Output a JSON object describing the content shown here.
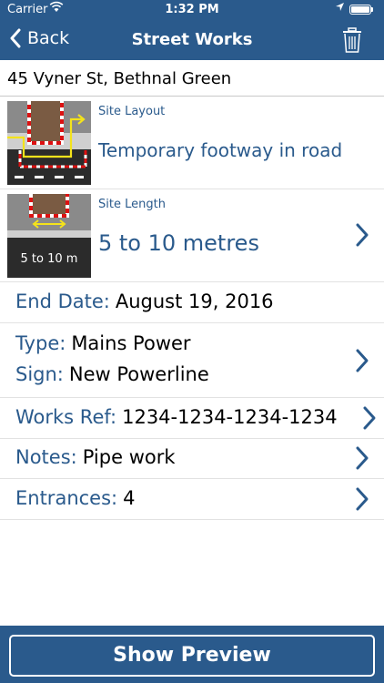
{
  "status_bar": {
    "carrier": "Carrier",
    "time": "1:32 PM"
  },
  "nav": {
    "back_label": "Back",
    "title": "Street Works"
  },
  "address": "45 Vyner St, Bethnal Green",
  "site_layout": {
    "label": "Site Layout",
    "value": "Temporary footway in road"
  },
  "site_length": {
    "label": "Site Length",
    "value": "5 to 10 metres",
    "thumb_label": "5 to 10 m"
  },
  "end_date": {
    "label": "End Date:",
    "value": "August 19, 2016"
  },
  "type": {
    "label": "Type:",
    "value": "Mains Power"
  },
  "sign": {
    "label": "Sign:",
    "value": "New Powerline"
  },
  "works_ref": {
    "label": "Works Ref:",
    "value": "1234-1234-1234-1234"
  },
  "notes": {
    "label": "Notes:",
    "value": "Pipe work"
  },
  "entrances": {
    "label": "Entrances:",
    "value": "4"
  },
  "preview_button": "Show Preview",
  "colors": {
    "accent": "#2a5a8c"
  }
}
